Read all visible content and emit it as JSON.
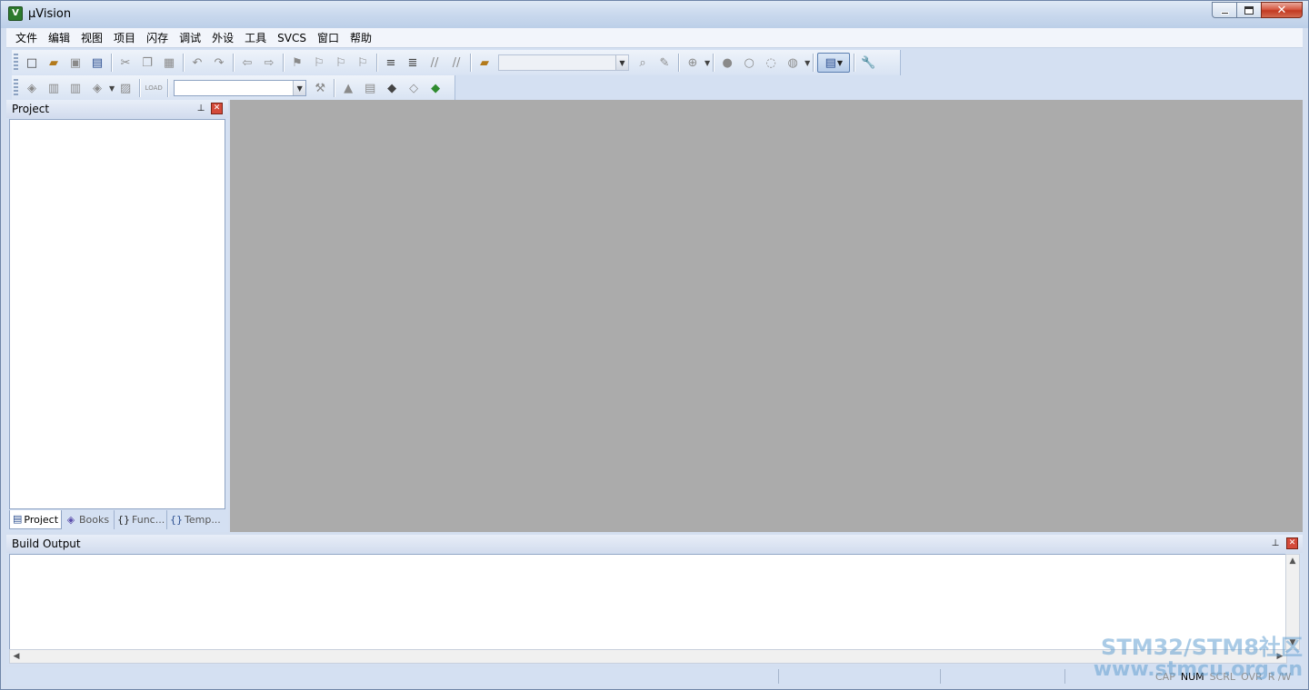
{
  "window": {
    "title": "µVision",
    "app_icon_letter": "V"
  },
  "menu": [
    "文件",
    "编辑",
    "视图",
    "项目",
    "闪存",
    "调试",
    "外设",
    "工具",
    "SVCS",
    "窗口",
    "帮助"
  ],
  "toolbar2": {
    "load_label": "LOAD"
  },
  "project_panel": {
    "title": "Project",
    "tabs": [
      "Project",
      "Books",
      "Func...",
      "Temp..."
    ]
  },
  "build_output": {
    "title": "Build Output"
  },
  "statusbar": {
    "indicators": [
      {
        "label": "CAP",
        "active": false
      },
      {
        "label": "NUM",
        "active": true
      },
      {
        "label": "SCRL",
        "active": false
      },
      {
        "label": "OVR",
        "active": false
      },
      {
        "label": "R /W",
        "active": false
      }
    ]
  },
  "watermark": {
    "line1": "STM32/STM8社区",
    "line2": "www.stmcu.org.cn"
  },
  "colors": {
    "main_bg": "#ababab",
    "frame": "#d4e0f2",
    "accent": "#2a4d8f"
  },
  "icons": [
    "new-file-icon",
    "open-folder-icon",
    "save-icon",
    "save-all-icon",
    "cut-icon",
    "copy-icon",
    "paste-icon",
    "undo-icon",
    "redo-icon",
    "nav-back-icon",
    "nav-forward-icon",
    "bookmark-icon",
    "indent-icon",
    "comment-icon",
    "find-in-files-icon",
    "zoom-icon",
    "breakpoint-icon",
    "window-select-icon",
    "wrench-icon",
    "translate-icon",
    "build-icon",
    "rebuild-icon",
    "batch-build-icon",
    "stop-build-icon",
    "load-icon",
    "target-options-icon",
    "manage-project-icon",
    "pack-installer-icon"
  ]
}
